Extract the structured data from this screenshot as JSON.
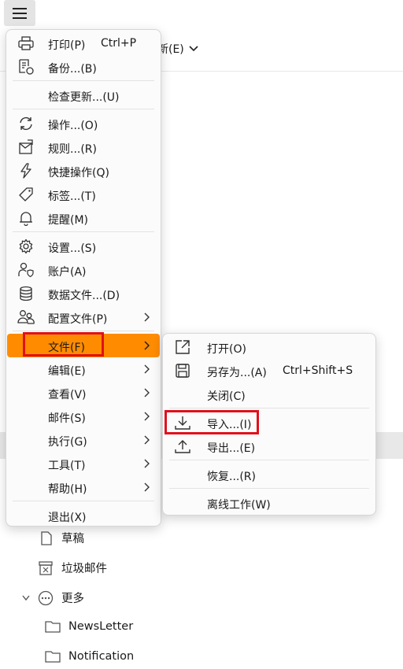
{
  "background": {
    "new_label": "新(E)",
    "folders": [
      {
        "label": "草稿",
        "icon": "draft-icon"
      },
      {
        "label": "垃圾邮件",
        "icon": "junk-icon"
      },
      {
        "label": "更多",
        "icon": "more-icon"
      },
      {
        "label": "NewsLetter",
        "icon": "folder-icon"
      },
      {
        "label": "Notification",
        "icon": "folder-icon"
      }
    ]
  },
  "main_menu": {
    "items": [
      {
        "label": "打印(P)",
        "shortcut": "Ctrl+P",
        "icon": "printer-icon"
      },
      {
        "label": "备份...(B)",
        "icon": "backup-icon"
      },
      {
        "label": "检查更新...(U)"
      },
      {
        "label": "操作...(O)",
        "icon": "sync-icon"
      },
      {
        "label": "规则...(R)",
        "icon": "rules-icon"
      },
      {
        "label": "快捷操作(Q)",
        "icon": "lightning-icon"
      },
      {
        "label": "标签...(T)",
        "icon": "tag-icon"
      },
      {
        "label": "提醒(M)",
        "icon": "bell-icon"
      },
      {
        "label": "设置...(S)",
        "icon": "gear-icon"
      },
      {
        "label": "账户(A)",
        "icon": "account-icon"
      },
      {
        "label": "数据文件...(D)",
        "icon": "database-icon"
      },
      {
        "label": "配置文件(P)",
        "icon": "profiles-icon"
      },
      {
        "label": "文件(F)"
      },
      {
        "label": "编辑(E)"
      },
      {
        "label": "查看(V)"
      },
      {
        "label": "邮件(S)"
      },
      {
        "label": "执行(G)"
      },
      {
        "label": "工具(T)"
      },
      {
        "label": "帮助(H)"
      },
      {
        "label": "退出(X)"
      }
    ]
  },
  "file_submenu": {
    "items": [
      {
        "label": "打开(O)",
        "icon": "open-icon"
      },
      {
        "label": "另存为...(A)",
        "shortcut": "Ctrl+Shift+S",
        "icon": "save-icon"
      },
      {
        "label": "关闭(C)"
      },
      {
        "label": "导入...(I)",
        "icon": "import-icon"
      },
      {
        "label": "导出...(E)",
        "icon": "export-icon"
      },
      {
        "label": "恢复...(R)"
      },
      {
        "label": "离线工作(W)"
      }
    ]
  },
  "colors": {
    "highlight": "#ff8c00",
    "annotation_box": "#e0101c"
  }
}
